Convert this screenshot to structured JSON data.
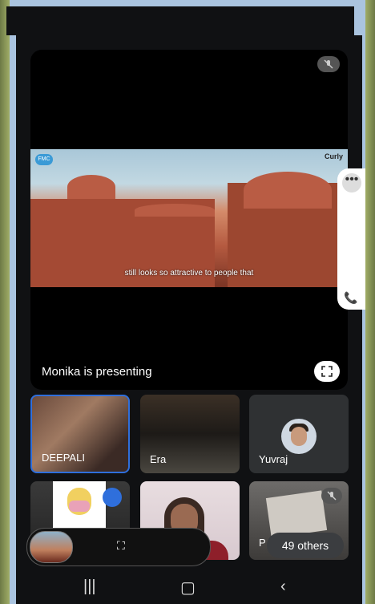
{
  "presenter": {
    "caption": "still looks so attractive to people that",
    "status": "Monika is presenting",
    "video_logo": "FMC",
    "video_brand": "Curly"
  },
  "participants": [
    {
      "name": "DEEPALI"
    },
    {
      "name": "Era"
    },
    {
      "name": "Yuvraj"
    },
    {
      "name": ""
    },
    {
      "name": ""
    },
    {
      "name": "P"
    }
  ],
  "others_label": "49 others",
  "icons": {
    "mic_off": "mic-off-icon",
    "fullscreen": "fullscreen-icon",
    "more": "more-dots-icon",
    "phone": "phone-icon",
    "pip_expand": "pip-expand-icon",
    "nav_recent": "recents-icon",
    "nav_home": "home-icon",
    "nav_back": "back-icon"
  },
  "colors": {
    "active_border": "#2f6fdc",
    "background": "#101113"
  }
}
